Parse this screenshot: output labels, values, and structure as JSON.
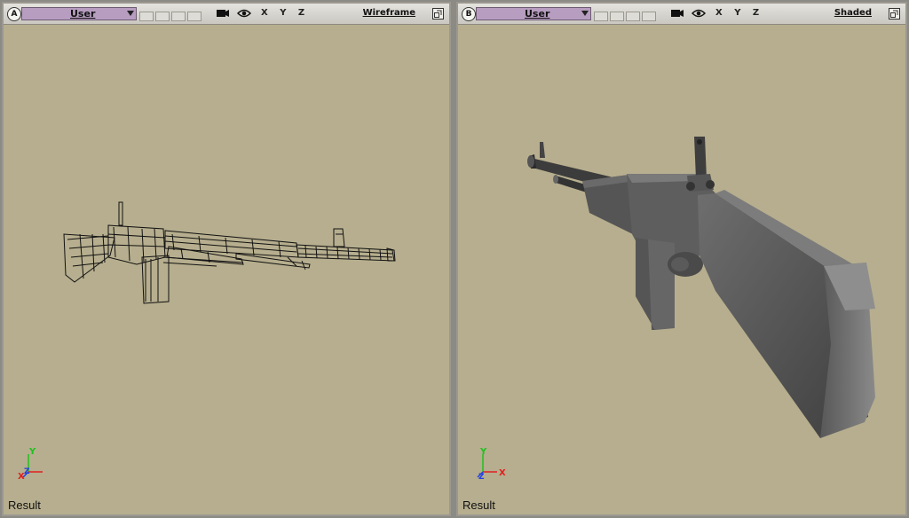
{
  "viewports": [
    {
      "id": "A",
      "camera": "User",
      "axes": "X Y Z",
      "mode": "Wireframe",
      "footer": "Result",
      "gizmo": {
        "y": "Y",
        "x": "X",
        "z": "Z"
      }
    },
    {
      "id": "B",
      "camera": "User",
      "axes": "X Y Z",
      "mode": "Shaded",
      "footer": "Result",
      "gizmo": {
        "y": "Y",
        "x": "X",
        "z": "Z"
      }
    }
  ],
  "colors": {
    "viewport_bg": "#b6ae8e",
    "camera_menu": "#b79dc0",
    "axis_x": "#e02020",
    "axis_y": "#20c020",
    "axis_z": "#2040e0"
  },
  "icons": [
    "camera-icon",
    "eye-icon",
    "maximize-icon",
    "chevron-down-icon"
  ]
}
